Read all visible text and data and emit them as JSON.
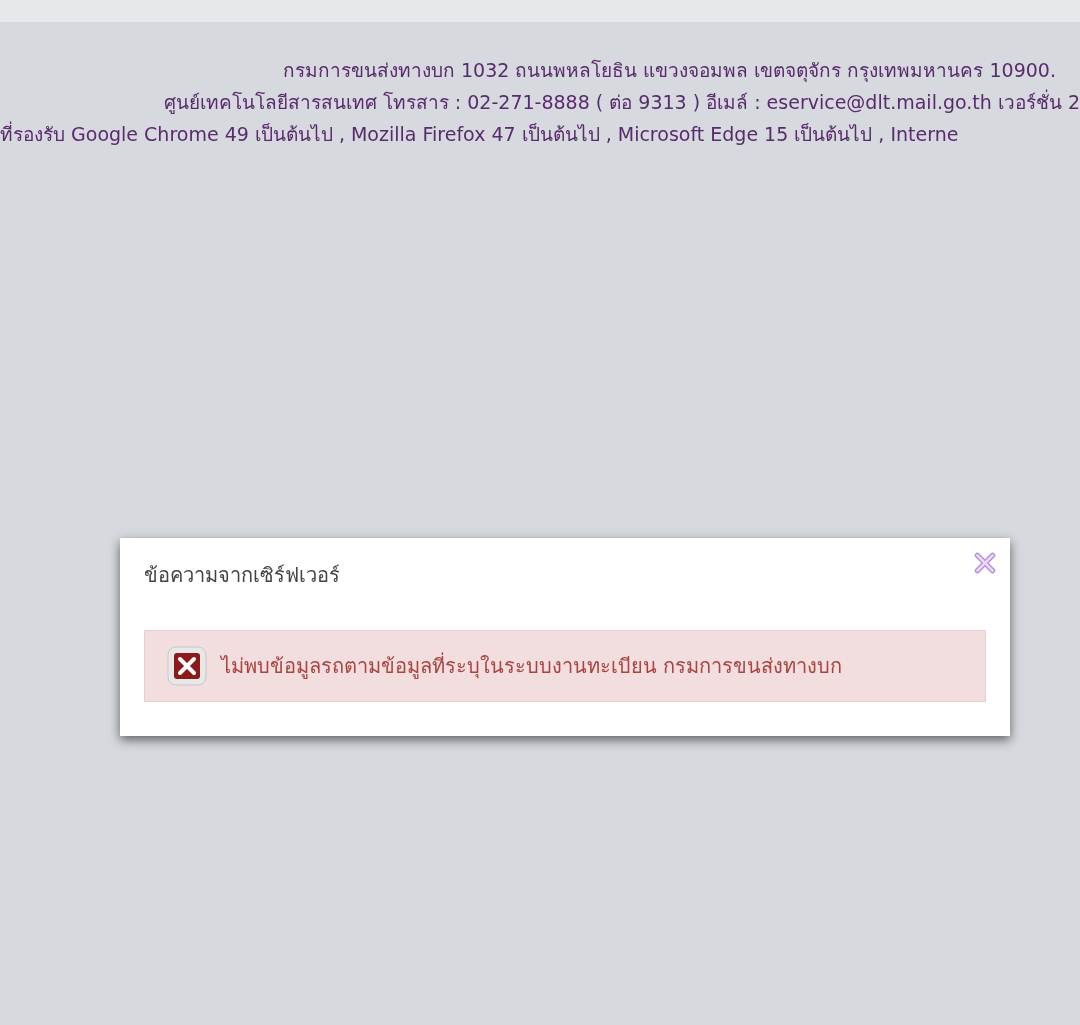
{
  "footer": {
    "lines": [
      "กรมการขนส่งทางบก 1032 ถนนพหลโยธิน แขวงจอมพล เขตจตุจักร กรุงเทพมหานคร 10900.",
      "ศูนย์เทคโนโลยีสารสนเทศ โทรสาร : 02-271-8888 ( ต่อ 9313 ) อีเมล์ : eservice@dlt.mail.go.th เวอร์ชั่น 2",
      "ที่รองรับ Google Chrome 49 เป็นต้นไป , Mozilla Firefox 47 เป็นต้นไป , Microsoft Edge 15 เป็นต้นไป , Interne"
    ]
  },
  "dialog": {
    "title": "ข้อความจากเซิร์ฟเวอร์",
    "message": {
      "kind": "error",
      "text": "ไม่พบข้อมูลรถตามข้อมูลที่ระบุในระบบงานทะเบียน กรมการขนส่งทางบก"
    }
  }
}
